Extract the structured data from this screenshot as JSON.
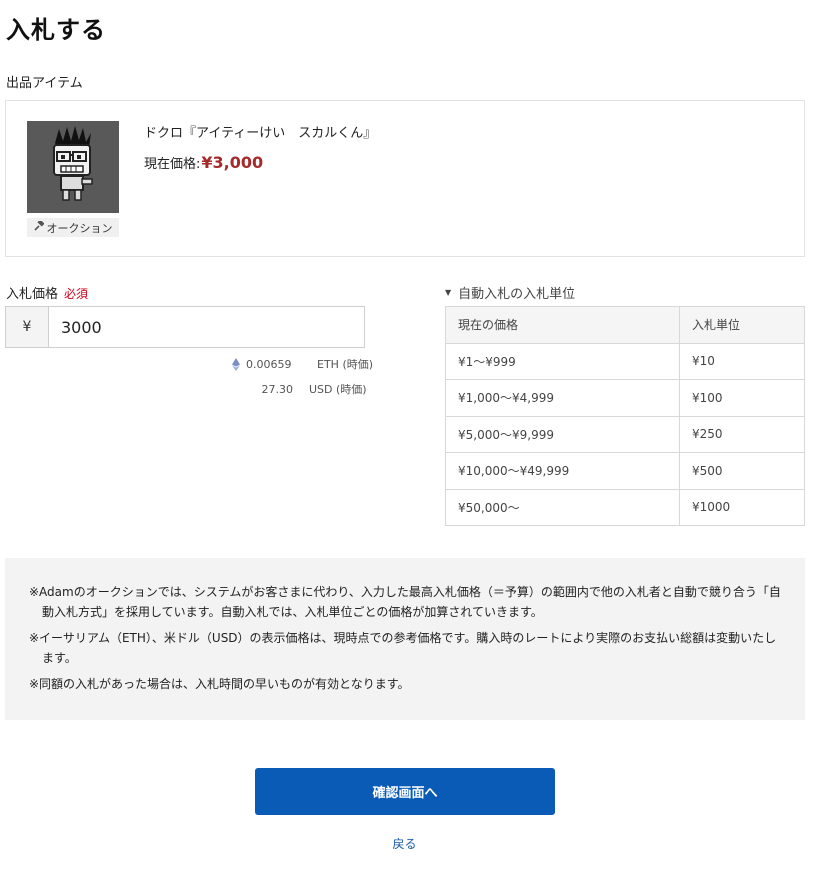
{
  "page": {
    "title": "入札する",
    "section_label": "出品アイテム"
  },
  "item": {
    "name": "ドクロ『アイティーけい　スカルくん』",
    "price_label": "現在価格:",
    "price_value": "¥3,000",
    "tag_label": "オークション",
    "tag_icon": "hammer-icon"
  },
  "bid": {
    "label": "入札価格",
    "required": "必須",
    "currency_prefix": "¥",
    "value": "3000"
  },
  "conversion": {
    "eth_value": "0.00659",
    "eth_unit": "ETH (時価)",
    "usd_value": "27.30",
    "usd_unit": "USD (時価)",
    "eth_icon": "ethereum-icon"
  },
  "auto_bid": {
    "title": "自動入札の入札単位",
    "headers": [
      "現在の価格",
      "入札単位"
    ],
    "rows": [
      [
        "¥1〜¥999",
        "¥10"
      ],
      [
        "¥1,000〜¥4,999",
        "¥100"
      ],
      [
        "¥5,000〜¥9,999",
        "¥250"
      ],
      [
        "¥10,000〜¥49,999",
        "¥500"
      ],
      [
        "¥50,000〜",
        "¥1000"
      ]
    ]
  },
  "notices": [
    "※Adamのオークションでは、システムがお客さまに代わり、入力した最高入札価格（＝予算）の範囲内で他の入札者と自動で競り合う「自動入札方式」を採用しています。自動入札では、入札単位ごとの価格が加算されていきます。",
    "※イーサリアム（ETH）、米ドル（USD）の表示価格は、現時点での参考価格です。購入時のレートにより実際のお支払い総額は変動いたします。",
    "※同額の入札があった場合は、入札時間の早いものが有効となります。"
  ],
  "actions": {
    "confirm": "確認画面へ",
    "back": "戻る"
  },
  "colors": {
    "accent": "#0a5bb5",
    "price": "#a52a2a",
    "required": "#d0021b"
  }
}
